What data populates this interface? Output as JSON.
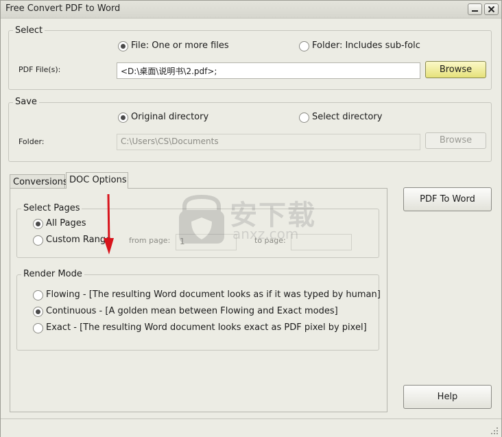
{
  "window": {
    "title": "Free Convert PDF to Word"
  },
  "select_group": {
    "legend": "Select",
    "file_radio": "File:  One or more files",
    "folder_radio": "Folder: Includes sub-folc",
    "pdf_label": "PDF File(s):",
    "pdf_value": "<D:\\桌面\\说明书\\2.pdf>;",
    "browse": "Browse"
  },
  "save_group": {
    "legend": "Save",
    "original_radio": "Original directory",
    "select_radio": "Select directory",
    "folder_label": "Folder:",
    "folder_value": "C:\\Users\\CS\\Documents",
    "browse": "Browse"
  },
  "tabs": [
    {
      "label": "Conversions"
    },
    {
      "label": "DOC Options"
    }
  ],
  "select_pages": {
    "legend": "Select Pages",
    "all_pages": "All Pages",
    "custom_range": "Custom Range",
    "from_page_label": "from page:",
    "from_page_value": "1",
    "to_page_label": "to page:",
    "to_page_value": ""
  },
  "render_mode": {
    "legend": "Render Mode",
    "flowing": "Flowing - [The resulting Word document looks as if it was typed by human]",
    "continuous": "Continuous - [A golden mean between Flowing and Exact modes]",
    "exact": "Exact - [The resulting Word document looks exact as PDF pixel by pixel]"
  },
  "buttons": {
    "pdf_to_word": "PDF To Word",
    "help": "Help"
  },
  "watermark": {
    "text": "安下载",
    "sub": "anxz.com"
  },
  "colors": {
    "browse_highlight": "#e6e27a",
    "arrow": "#d8141c"
  }
}
